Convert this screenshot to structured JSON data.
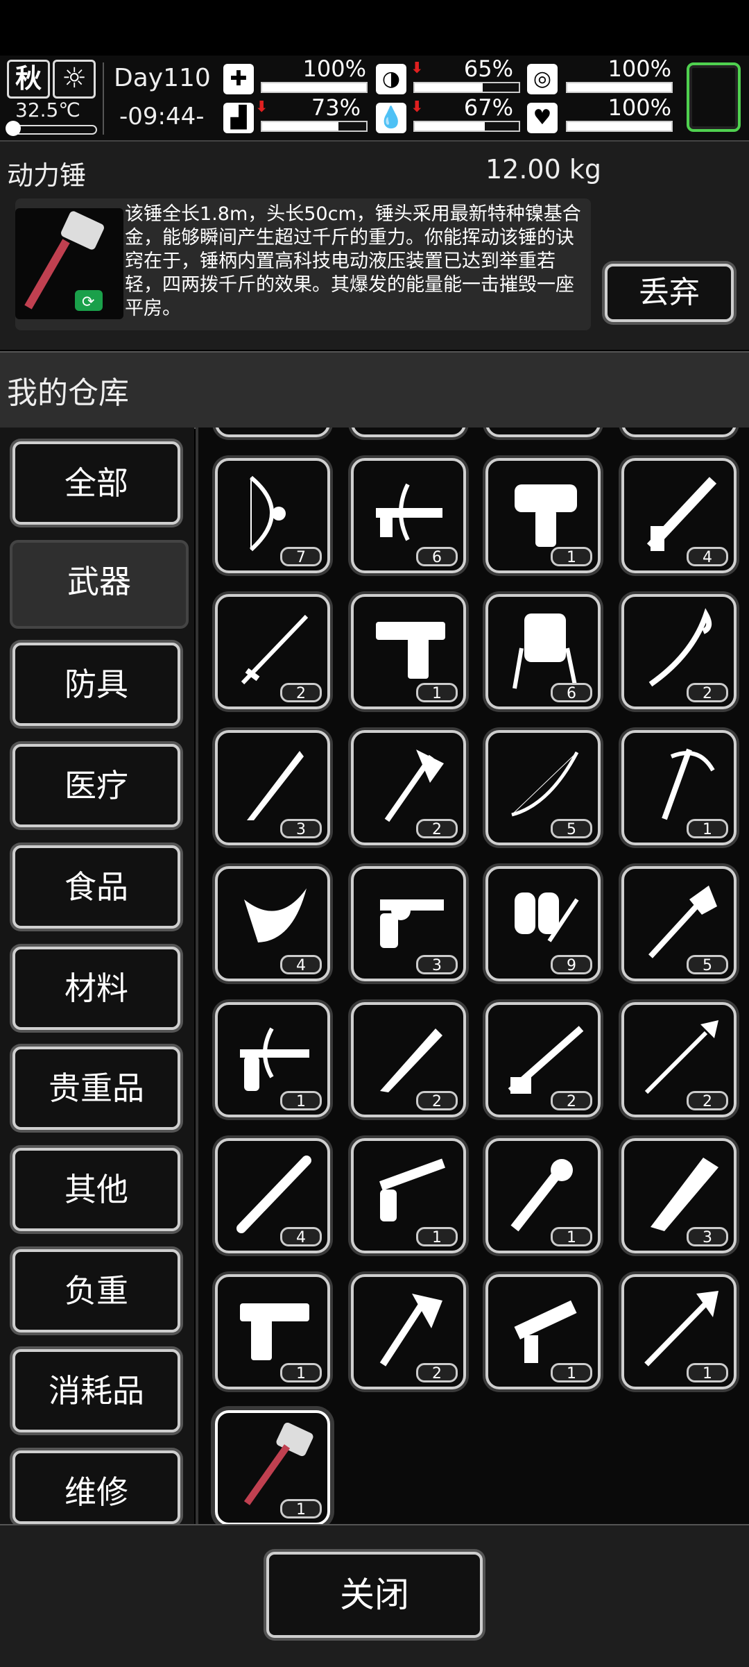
{
  "status": {
    "season": "秋",
    "weather_icon": "sun-icon",
    "temperature": "32.5℃",
    "day": "Day110",
    "time": "-09:44-",
    "stats": [
      {
        "name": "health",
        "icon": "medkit-icon",
        "value": "100%",
        "level": 1.0,
        "down": false
      },
      {
        "name": "hunger",
        "icon": "stomach-icon",
        "value": "65%",
        "level": 0.65,
        "down": true
      },
      {
        "name": "armor",
        "icon": "armor-icon",
        "value": "100%",
        "level": 1.0,
        "down": false
      },
      {
        "name": "stamina",
        "icon": "boot-icon",
        "value": "73%",
        "level": 0.73,
        "down": true
      },
      {
        "name": "thirst",
        "icon": "water-drop-icon",
        "value": "67%",
        "level": 0.67,
        "down": true
      },
      {
        "name": "mood",
        "icon": "heart-icon",
        "value": "100%",
        "level": 1.0,
        "down": false
      }
    ]
  },
  "item": {
    "name": "动力锤",
    "weight": "12.00 kg",
    "description": "该锤全长1.8m，头长50cm，锤头采用最新特种镍基合金，能够瞬间产生超过千斤的重力。你能挥动该锤的诀窍在于，锤柄内置高科技电动液压装置已达到举重若轻，四两拨千斤的效果。其爆发的能量能一击摧毁一座平房。",
    "discard_label": "丢弃"
  },
  "warehouse": {
    "title": "我的仓库",
    "categories": [
      "全部",
      "武器",
      "防具",
      "医疗",
      "食品",
      "材料",
      "贵重品",
      "其他",
      "负重",
      "消耗品",
      "维修"
    ],
    "active_category": "武器",
    "items": [
      {
        "icon": "compound-bow-icon",
        "count": "7"
      },
      {
        "icon": "crossbow-icon",
        "count": "6"
      },
      {
        "icon": "taser-gun-icon",
        "count": "1"
      },
      {
        "icon": "caulking-gun-icon",
        "count": "4"
      },
      {
        "icon": "katana-icon",
        "count": "2"
      },
      {
        "icon": "desert-eagle-icon",
        "count": "1"
      },
      {
        "icon": "folding-chair-icon",
        "count": "6"
      },
      {
        "icon": "crowbar-icon",
        "count": "2"
      },
      {
        "icon": "combat-knife-icon",
        "count": "3"
      },
      {
        "icon": "battle-axe-icon",
        "count": "2"
      },
      {
        "icon": "recurve-bow-icon",
        "count": "5"
      },
      {
        "icon": "ice-pick-icon",
        "count": "1"
      },
      {
        "icon": "kukri-icon",
        "count": "4"
      },
      {
        "icon": "revolver-icon",
        "count": "3"
      },
      {
        "icon": "flamethrower-icon",
        "count": "9"
      },
      {
        "icon": "shovel-icon",
        "count": "5"
      },
      {
        "icon": "pistol-crossbow-icon",
        "count": "1"
      },
      {
        "icon": "machete-icon",
        "count": "2"
      },
      {
        "icon": "shotgun-icon",
        "count": "2"
      },
      {
        "icon": "spear-icon",
        "count": "2"
      },
      {
        "icon": "baseball-bat-icon",
        "count": "4"
      },
      {
        "icon": "long-revolver-icon",
        "count": "1"
      },
      {
        "icon": "spiked-club-icon",
        "count": "1"
      },
      {
        "icon": "cleaver-blade-icon",
        "count": "3"
      },
      {
        "icon": "handgun-icon",
        "count": "1"
      },
      {
        "icon": "hatchet-icon",
        "count": "2"
      },
      {
        "icon": "submachine-gun-icon",
        "count": "1"
      },
      {
        "icon": "halberd-icon",
        "count": "1"
      },
      {
        "icon": "power-hammer-icon",
        "count": "1"
      }
    ]
  },
  "footer": {
    "close_label": "关闭"
  }
}
